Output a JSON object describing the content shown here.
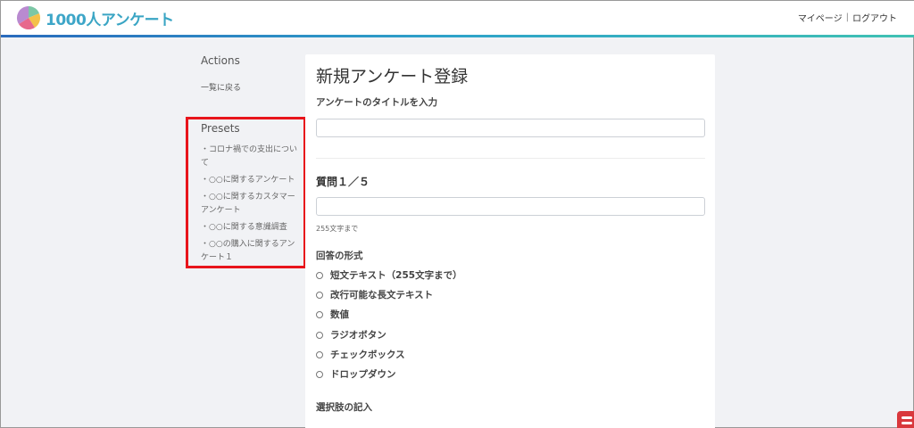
{
  "header": {
    "logo_text_num": "1000",
    "logo_text_kana": "人アンケート",
    "mypage_label": "マイページ",
    "separator": "|",
    "logout_label": "ログアウト"
  },
  "sidebar": {
    "actions_heading": "Actions",
    "back_link": "一覧に戻る",
    "presets_heading": "Presets",
    "presets": [
      "・コロナ禍での支出について",
      "・○○に関するアンケート",
      "・○○に関するカスタマーアンケート",
      "・○○に関する意識調査",
      "・○○の購入に関するアンケート１"
    ]
  },
  "form": {
    "page_title": "新規アンケート登録",
    "title_label": "アンケートのタイトルを入力",
    "title_value": "",
    "question_heading": "質問１／５",
    "question_value": "",
    "question_hint": "255文字まで",
    "answer_format_label": "回答の形式",
    "answer_options": [
      "短文テキスト（255文字まで）",
      "改行可能な長文テキスト",
      "数値",
      "ラジオボタン",
      "チェックボックス",
      "ドロップダウン"
    ],
    "choices_label": "選択肢の記入"
  },
  "colors": {
    "accent_blue": "#2d9cbf",
    "highlight_red": "#e8141b",
    "background": "#f1f2f5"
  }
}
